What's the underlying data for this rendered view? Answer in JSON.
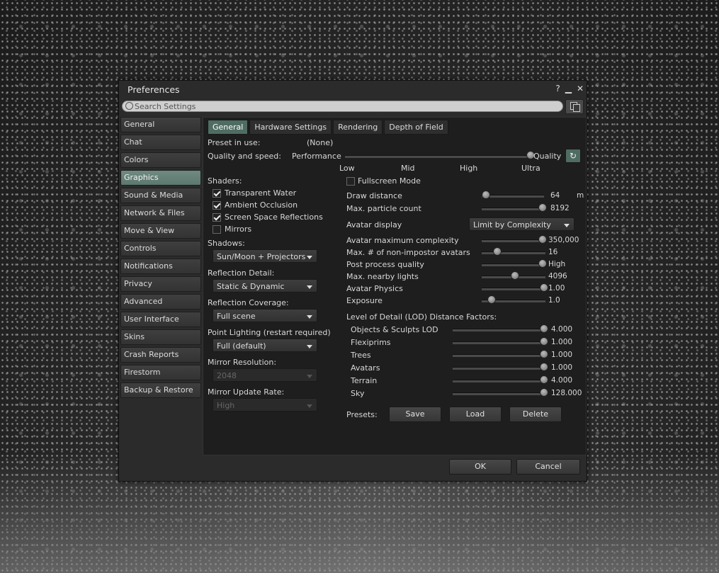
{
  "window": {
    "title": "Preferences",
    "help": "?",
    "minimize": "▁",
    "close": "✕"
  },
  "search": {
    "placeholder": "Search Settings"
  },
  "sidebar": {
    "items": [
      "General",
      "Chat",
      "Colors",
      "Graphics",
      "Sound & Media",
      "Network & Files",
      "Move & View",
      "Controls",
      "Notifications",
      "Privacy",
      "Advanced",
      "User Interface",
      "Skins",
      "Crash Reports",
      "Firestorm",
      "Backup & Restore"
    ],
    "active": "Graphics"
  },
  "tabs": [
    "General",
    "Hardware Settings",
    "Rendering",
    "Depth of Field"
  ],
  "preset": {
    "label": "Preset in use:",
    "value": "(None)"
  },
  "quality": {
    "label": "Quality and speed:",
    "left": "Performance",
    "right": "Quality",
    "ticks": [
      "Low",
      "Mid",
      "High",
      "Ultra"
    ],
    "level": 1.0
  },
  "shaders": {
    "label": "Shaders:",
    "items": [
      {
        "label": "Transparent Water",
        "checked": true
      },
      {
        "label": "Ambient Occlusion",
        "checked": true
      },
      {
        "label": "Screen Space Reflections",
        "checked": true
      },
      {
        "label": "Mirrors",
        "checked": false
      }
    ]
  },
  "combos": {
    "shadows": {
      "label": "Shadows:",
      "value": "Sun/Moon + Projectors"
    },
    "reflection_detail": {
      "label": "Reflection Detail:",
      "value": "Static & Dynamic"
    },
    "reflection_coverage": {
      "label": "Reflection Coverage:",
      "value": "Full scene"
    },
    "point_lighting": {
      "label": "Point Lighting (restart required)",
      "value": "Full (default)"
    },
    "mirror_resolution": {
      "label": "Mirror Resolution:",
      "value": "2048"
    },
    "mirror_update": {
      "label": "Mirror Update Rate:",
      "value": "High"
    }
  },
  "fullscreen": {
    "label": "Fullscreen Mode",
    "checked": false
  },
  "right_sliders": [
    {
      "label": "Draw distance",
      "value": "64",
      "unit": "m",
      "level": 0.0
    },
    {
      "label": "Max. particle count",
      "value": "8192",
      "level": 1.0
    }
  ],
  "avatar_display": {
    "label": "Avatar display",
    "value": "Limit by Complexity"
  },
  "right_sliders2": [
    {
      "label": "Avatar maximum complexity",
      "value": "350,000",
      "level": 0.97
    },
    {
      "label": "Max. # of non-impostor avatars",
      "value": "16",
      "level": 0.2
    },
    {
      "label": "Post process quality",
      "value": "High",
      "level": 0.97
    },
    {
      "label": "Max. nearby lights",
      "value": "4096",
      "level": 0.5
    },
    {
      "label": "Avatar Physics",
      "value": "1.00",
      "level": 1.0
    },
    {
      "label": "Exposure",
      "value": "1.0",
      "level": 0.1
    }
  ],
  "lod": {
    "label": "Level of Detail (LOD) Distance Factors:",
    "items": [
      {
        "label": "Objects & Sculpts LOD",
        "value": "4.000",
        "level": 1.0
      },
      {
        "label": "Flexiprims",
        "value": "1.000",
        "level": 1.0
      },
      {
        "label": "Trees",
        "value": "1.000",
        "level": 1.0
      },
      {
        "label": "Avatars",
        "value": "1.000",
        "level": 1.0
      },
      {
        "label": "Terrain",
        "value": "4.000",
        "level": 1.0
      },
      {
        "label": "Sky",
        "value": "128.000",
        "level": 1.0
      }
    ]
  },
  "presets": {
    "label": "Presets:",
    "save": "Save",
    "load": "Load",
    "delete": "Delete"
  },
  "footer": {
    "ok": "OK",
    "cancel": "Cancel"
  }
}
